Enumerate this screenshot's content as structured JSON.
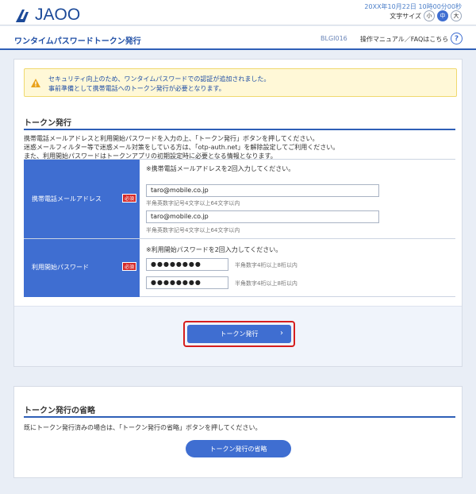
{
  "header": {
    "logo_text": "JAOO",
    "datetime": "20XX年10月22日 10時00分00秒",
    "font_size_label": "文字サイズ",
    "font_sizes": [
      "小",
      "中",
      "大"
    ],
    "font_size_selected": "中",
    "accent_color": "#3f6ed1"
  },
  "titlebar": {
    "page_title": "ワンタイムパスワードトークン発行",
    "screen_id": "BLGI016",
    "help_link": "操作マニュアル／FAQはこちら",
    "help_icon": "question-circle-icon"
  },
  "notice": {
    "icon": "warning-icon",
    "line1": "セキュリティ向上のため、ワンタイムパスワードでの認証が追加されました。",
    "line2": "事前準備として携帯電話へのトークン発行が必要となります。"
  },
  "token_issue": {
    "title": "トークン発行",
    "desc1": "携帯電話メールアドレスと利用開始パスワードを入力の上、「トークン発行」ボタンを押してください。",
    "desc2": "迷惑メールフィルター等で迷惑メール対策をしている方は、「otp-auth.net」を解除設定してご利用ください。",
    "desc3": "また、利用開始パスワードはトークンアプリの初期設定時に必要となる情報となります。",
    "email": {
      "label": "携帯電話メールアドレス",
      "required": "必須",
      "hint": "※携帯電話メールアドレスを2回入力してください。",
      "value1": "taro@mobile.co.jp",
      "value2": "taro@mobile.co.jp",
      "sub_hint1": "半角英数字記号4文字以上64文字以内",
      "sub_hint2": "半角英数字記号4文字以上64文字以内"
    },
    "password": {
      "label": "利用開始パスワード",
      "required": "必須",
      "hint": "※利用開始パスワードを2回入力してください。",
      "value1": "●●●●●●●●",
      "value2": "●●●●●●●●",
      "sub_hint1": "半角数字4桁以上8桁以内",
      "sub_hint2": "半角数字4桁以上8桁以内"
    },
    "button_label": "トークン発行",
    "button_icon": "chevron-right-icon"
  },
  "skip": {
    "title": "トークン発行の省略",
    "desc": "既にトークン発行済みの場合は、「トークン発行の省略」ボタンを押してください。",
    "button_label": "トークン発行の省略"
  }
}
